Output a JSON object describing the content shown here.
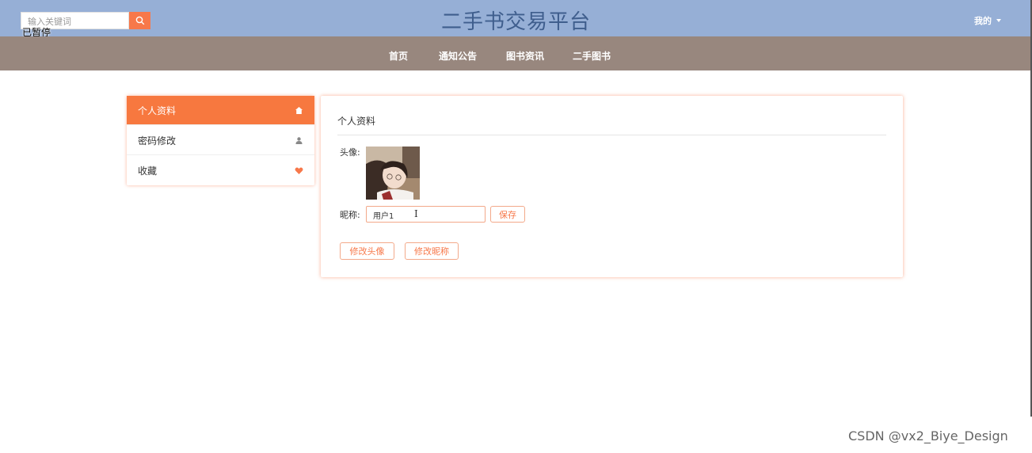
{
  "header": {
    "search_placeholder": "输入关键词",
    "tooltip": "已暂停",
    "site_title": "二手书交易平台",
    "user_menu": "我的"
  },
  "nav": {
    "items": [
      {
        "label": "首页"
      },
      {
        "label": "通知公告"
      },
      {
        "label": "图书资讯"
      },
      {
        "label": "二手图书"
      }
    ]
  },
  "sidebar": {
    "items": [
      {
        "label": "个人资料",
        "icon": "home-icon",
        "active": true
      },
      {
        "label": "密码修改",
        "icon": "user-icon",
        "active": false
      },
      {
        "label": "收藏",
        "icon": "heart-icon",
        "active": false
      }
    ]
  },
  "profile": {
    "title": "个人资料",
    "avatar_label": "头像:",
    "nickname_label": "昵称:",
    "nickname_value": "用户1",
    "save_label": "保存",
    "change_avatar_label": "修改头像",
    "change_nickname_label": "修改昵称"
  },
  "watermark": "CSDN @vx2_Biye_Design",
  "colors": {
    "topbar": "#96afd6",
    "navbar": "#98877e",
    "accent": "#f7784a"
  }
}
